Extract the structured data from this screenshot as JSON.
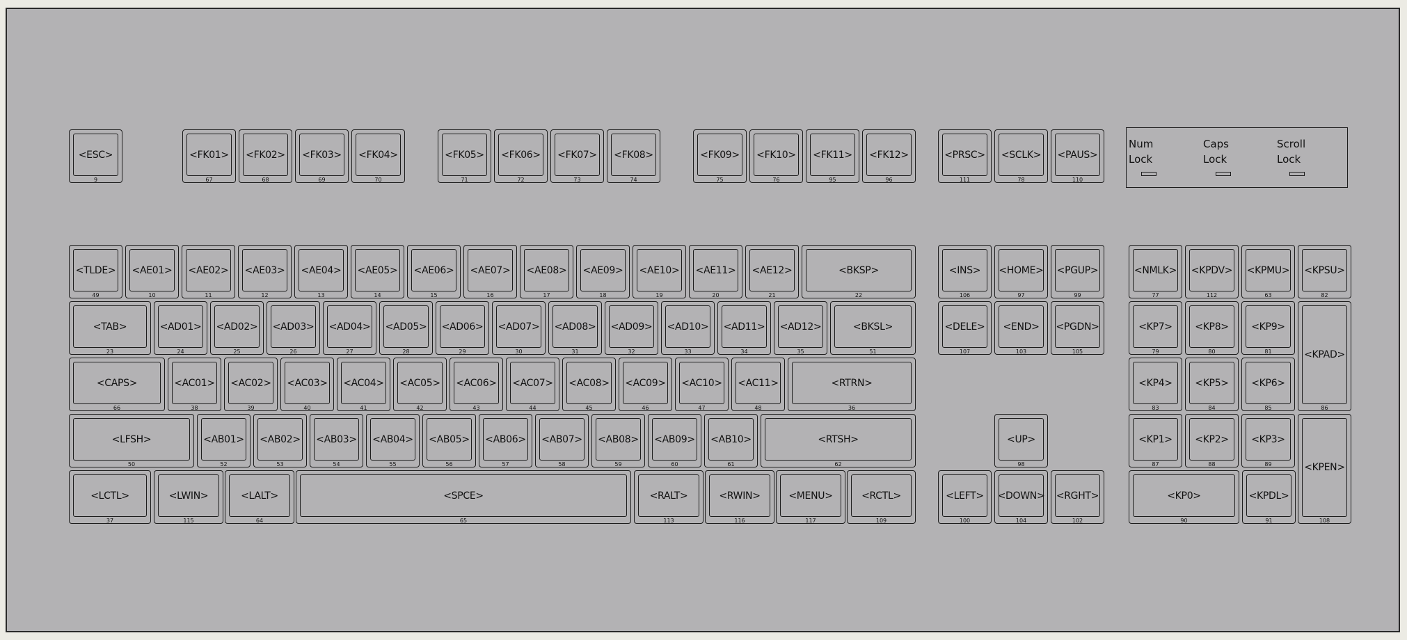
{
  "keyboard": {
    "background_color": "#b3b2b4",
    "outline_color": "#1d1d1d",
    "rows": [
      [
        {
          "label": "<ESC>",
          "code": "9"
        },
        {
          "label": "<FK01>",
          "code": "67"
        },
        {
          "label": "<FK02>",
          "code": "68"
        },
        {
          "label": "<FK03>",
          "code": "69"
        },
        {
          "label": "<FK04>",
          "code": "70"
        },
        {
          "label": "<FK05>",
          "code": "71"
        },
        {
          "label": "<FK06>",
          "code": "72"
        },
        {
          "label": "<FK07>",
          "code": "73"
        },
        {
          "label": "<FK08>",
          "code": "74"
        },
        {
          "label": "<FK09>",
          "code": "75"
        },
        {
          "label": "<FK10>",
          "code": "76"
        },
        {
          "label": "<FK11>",
          "code": "95"
        },
        {
          "label": "<FK12>",
          "code": "96"
        },
        {
          "label": "<PRSC>",
          "code": "111"
        },
        {
          "label": "<SCLK>",
          "code": "78"
        },
        {
          "label": "<PAUS>",
          "code": "110"
        }
      ],
      [
        {
          "label": "<TLDE>",
          "code": "49"
        },
        {
          "label": "<AE01>",
          "code": "10"
        },
        {
          "label": "<AE02>",
          "code": "11"
        },
        {
          "label": "<AE03>",
          "code": "12"
        },
        {
          "label": "<AE04>",
          "code": "13"
        },
        {
          "label": "<AE05>",
          "code": "14"
        },
        {
          "label": "<AE06>",
          "code": "15"
        },
        {
          "label": "<AE07>",
          "code": "16"
        },
        {
          "label": "<AE08>",
          "code": "17"
        },
        {
          "label": "<AE09>",
          "code": "18"
        },
        {
          "label": "<AE10>",
          "code": "19"
        },
        {
          "label": "<AE11>",
          "code": "20"
        },
        {
          "label": "<AE12>",
          "code": "21"
        },
        {
          "label": "<BKSP>",
          "code": "22"
        },
        {
          "label": "<INS>",
          "code": "106"
        },
        {
          "label": "<HOME>",
          "code": "97"
        },
        {
          "label": "<PGUP>",
          "code": "99"
        },
        {
          "label": "<NMLK>",
          "code": "77"
        },
        {
          "label": "<KPDV>",
          "code": "112"
        },
        {
          "label": "<KPMU>",
          "code": "63"
        },
        {
          "label": "<KPSU>",
          "code": "82"
        }
      ],
      [
        {
          "label": "<TAB>",
          "code": "23"
        },
        {
          "label": "<AD01>",
          "code": "24"
        },
        {
          "label": "<AD02>",
          "code": "25"
        },
        {
          "label": "<AD03>",
          "code": "26"
        },
        {
          "label": "<AD04>",
          "code": "27"
        },
        {
          "label": "<AD05>",
          "code": "28"
        },
        {
          "label": "<AD06>",
          "code": "29"
        },
        {
          "label": "<AD07>",
          "code": "30"
        },
        {
          "label": "<AD08>",
          "code": "31"
        },
        {
          "label": "<AD09>",
          "code": "32"
        },
        {
          "label": "<AD10>",
          "code": "33"
        },
        {
          "label": "<AD11>",
          "code": "34"
        },
        {
          "label": "<AD12>",
          "code": "35"
        },
        {
          "label": "<BKSL>",
          "code": "51"
        },
        {
          "label": "<DELE>",
          "code": "107"
        },
        {
          "label": "<END>",
          "code": "103"
        },
        {
          "label": "<PGDN>",
          "code": "105"
        },
        {
          "label": "<KP7>",
          "code": "79"
        },
        {
          "label": "<KP8>",
          "code": "80"
        },
        {
          "label": "<KP9>",
          "code": "81"
        },
        {
          "label": "<KPAD>",
          "code": "86"
        }
      ],
      [
        {
          "label": "<CAPS>",
          "code": "66"
        },
        {
          "label": "<AC01>",
          "code": "38"
        },
        {
          "label": "<AC02>",
          "code": "39"
        },
        {
          "label": "<AC03>",
          "code": "40"
        },
        {
          "label": "<AC04>",
          "code": "41"
        },
        {
          "label": "<AC05>",
          "code": "42"
        },
        {
          "label": "<AC06>",
          "code": "43"
        },
        {
          "label": "<AC07>",
          "code": "44"
        },
        {
          "label": "<AC08>",
          "code": "45"
        },
        {
          "label": "<AC09>",
          "code": "46"
        },
        {
          "label": "<AC10>",
          "code": "47"
        },
        {
          "label": "<AC11>",
          "code": "48"
        },
        {
          "label": "<RTRN>",
          "code": "36"
        },
        {
          "label": "<KP4>",
          "code": "83"
        },
        {
          "label": "<KP5>",
          "code": "84"
        },
        {
          "label": "<KP6>",
          "code": "85"
        }
      ],
      [
        {
          "label": "<LFSH>",
          "code": "50"
        },
        {
          "label": "<AB01>",
          "code": "52"
        },
        {
          "label": "<AB02>",
          "code": "53"
        },
        {
          "label": "<AB03>",
          "code": "54"
        },
        {
          "label": "<AB04>",
          "code": "55"
        },
        {
          "label": "<AB05>",
          "code": "56"
        },
        {
          "label": "<AB06>",
          "code": "57"
        },
        {
          "label": "<AB07>",
          "code": "58"
        },
        {
          "label": "<AB08>",
          "code": "59"
        },
        {
          "label": "<AB09>",
          "code": "60"
        },
        {
          "label": "<AB10>",
          "code": "61"
        },
        {
          "label": "<RTSH>",
          "code": "62"
        },
        {
          "label": "<UP>",
          "code": "98"
        },
        {
          "label": "<KP1>",
          "code": "87"
        },
        {
          "label": "<KP2>",
          "code": "88"
        },
        {
          "label": "<KP3>",
          "code": "89"
        },
        {
          "label": "<KPEN>",
          "code": "108"
        }
      ],
      [
        {
          "label": "<LCTL>",
          "code": "37"
        },
        {
          "label": "<LWIN>",
          "code": "115"
        },
        {
          "label": "<LALT>",
          "code": "64"
        },
        {
          "label": "<SPCE>",
          "code": "65"
        },
        {
          "label": "<RALT>",
          "code": "113"
        },
        {
          "label": "<RWIN>",
          "code": "116"
        },
        {
          "label": "<MENU>",
          "code": "117"
        },
        {
          "label": "<RCTL>",
          "code": "109"
        },
        {
          "label": "<LEFT>",
          "code": "100"
        },
        {
          "label": "<DOWN>",
          "code": "104"
        },
        {
          "label": "<RGHT>",
          "code": "102"
        },
        {
          "label": "<KP0>",
          "code": "90"
        },
        {
          "label": "<KPDL>",
          "code": "91"
        }
      ]
    ],
    "leds": [
      "Num\nLock",
      "Caps\nLock",
      "Scroll\nLock"
    ]
  }
}
